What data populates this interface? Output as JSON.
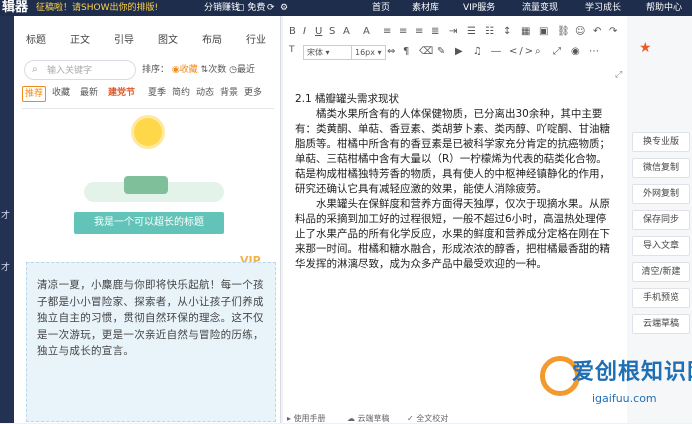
{
  "topbar": {
    "brand": "辑器",
    "slogan": "征稿啦！请SHOW出你的排版!",
    "earn": "分销赚钱",
    "free": "免费",
    "nav": [
      "首页",
      "素材库",
      "VIP服务",
      "流量变现",
      "学习成长",
      "帮助中心"
    ]
  },
  "left_edge": [
    "才",
    "才"
  ],
  "left_panel": {
    "categories": [
      "标题",
      "正文",
      "引导",
      "图文",
      "布局",
      "行业"
    ],
    "search_placeholder": "输入关键字",
    "sort_label": "排序：",
    "sort_hot": "收藏",
    "sort_count": "次数",
    "sort_latest": "最近",
    "subtabs": [
      "推荐",
      "收藏",
      "最新",
      "建党节",
      "夏季",
      "简约",
      "动态",
      "背景",
      "更多"
    ],
    "vip_badge": "VIP",
    "banner_title": "我是一个可以超长的标题",
    "card_text": "清凉一夏，小麋鹿与你即将快乐起航！每一个孩子都是小小冒险家、探索者，从小让孩子们养成独立自主的习惯，贯彻自然环保的理念。这不仅是一次游玩，更是一次亲近自然与冒险的历练，独立与成长的宣言。"
  },
  "editor": {
    "font_name": "宋体",
    "font_size": "16px",
    "heading": "2.1 橘瓣罐头需求现状",
    "paragraphs": [
      "橘类水果所含有的人体保健物质，已分离出30余种，其中主要有：类黄酮、单萜、香豆素、类胡萝卜素、类丙醇、吖啶酮、甘油糖脂质等。柑橘中所含有的香豆素是已被科学家充分肯定的抗癌物质；单萜、三萜柑橘中含有大量以（R）一柠檬烯为代表的萜类化合物。萜是构成柑橘独特芳香的物质，具有使人的中枢神经镇静化的作用，研究还确认它具有减轻应激的效果，能使人消除疲劳。",
      "水果罐头在保鲜度和营养方面得天独厚，仅次于现摘水果。从原料品的采摘到加工好的过程很短，一般不超过6小时，高温热处理停止了水果产品的所有化学反应，水果的鲜度和营养成分定格在刚在下来那一时间。柑橘和糖水融合，形成浓浓的醇香，把柑橘最香甜的精华发挥的淋漓尽致，成为众多产品中最受欢迎的一种。"
    ],
    "bottom_items": [
      "使用手册",
      "云端草稿",
      "全文校对"
    ]
  },
  "right_panel": {
    "buttons": [
      "换专业版",
      "微信复制",
      "外网复制",
      "保存同步",
      "导入文章",
      "清空/新建",
      "手机预览",
      "云端草稿"
    ]
  },
  "watermark": {
    "text": "爱创根知识网",
    "url": "igaifuu.com"
  }
}
